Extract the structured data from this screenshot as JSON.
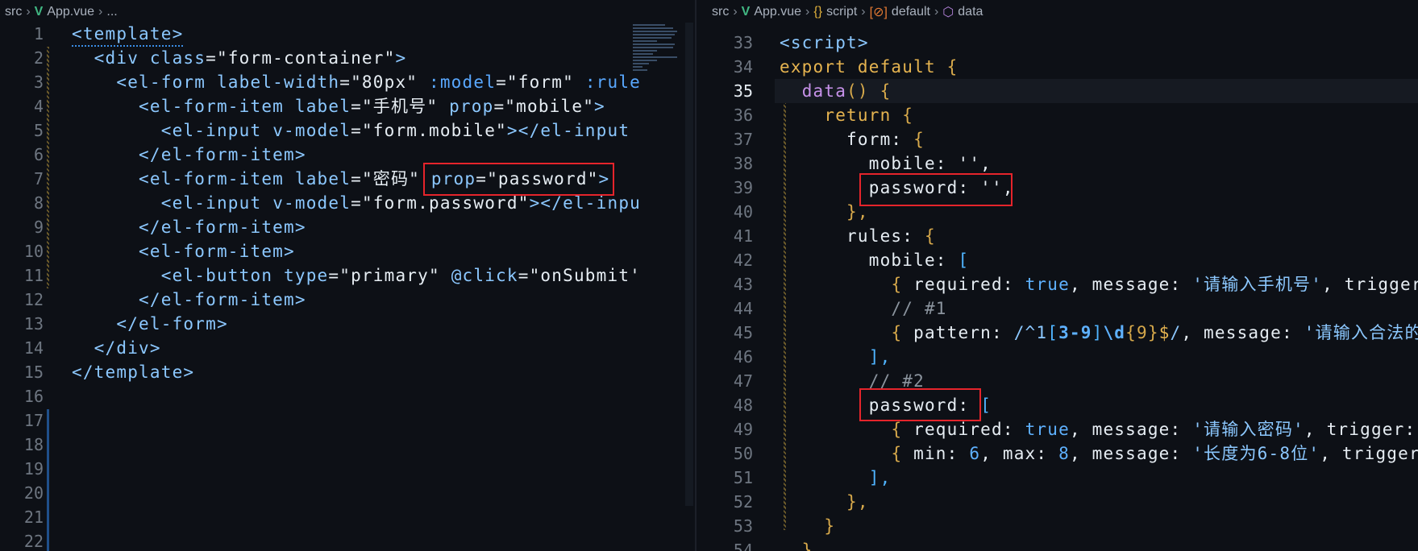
{
  "left": {
    "breadcrumb": [
      "src",
      "App.vue",
      "..."
    ],
    "lines": [
      {
        "n": "1",
        "tokens": [
          [
            "<template>",
            "t"
          ]
        ]
      },
      {
        "n": "2",
        "tokens": [
          [
            "  <div ",
            "t"
          ],
          [
            "class",
            "a"
          ],
          [
            "=",
            "p"
          ],
          [
            "\"form-container\"",
            "s"
          ],
          [
            ">",
            "t"
          ]
        ]
      },
      {
        "n": "3",
        "tokens": [
          [
            "    <el-form ",
            "t"
          ],
          [
            "label-width",
            "a"
          ],
          [
            "=",
            "p"
          ],
          [
            "\"80px\" ",
            "s"
          ],
          [
            ":model",
            "d"
          ],
          [
            "=",
            "p"
          ],
          [
            "\"form\" ",
            "s"
          ],
          [
            ":rule",
            "d"
          ]
        ]
      },
      {
        "n": "4",
        "tokens": [
          [
            "      <el-form-item ",
            "t"
          ],
          [
            "label",
            "a"
          ],
          [
            "=",
            "p"
          ],
          [
            "\"手机号\" ",
            "s"
          ],
          [
            "prop",
            "a"
          ],
          [
            "=",
            "p"
          ],
          [
            "\"mobile\"",
            "s"
          ],
          [
            ">",
            "t"
          ]
        ]
      },
      {
        "n": "5",
        "tokens": [
          [
            "        <el-input ",
            "t"
          ],
          [
            "v-model",
            "a"
          ],
          [
            "=",
            "p"
          ],
          [
            "\"form.mobile\"",
            "s"
          ],
          [
            "></el-input",
            "t"
          ]
        ]
      },
      {
        "n": "6",
        "tokens": [
          [
            "      </el-form-item>",
            "t"
          ]
        ]
      },
      {
        "n": "7",
        "tokens": [
          [
            "      <el-form-item ",
            "t"
          ],
          [
            "label",
            "a"
          ],
          [
            "=",
            "p"
          ],
          [
            "\"密码\" ",
            "s"
          ],
          [
            "prop",
            "a"
          ],
          [
            "=",
            "p"
          ],
          [
            "\"password\"",
            "s"
          ],
          [
            ">",
            "t"
          ]
        ]
      },
      {
        "n": "8",
        "tokens": [
          [
            "        <el-input ",
            "t"
          ],
          [
            "v-model",
            "a"
          ],
          [
            "=",
            "p"
          ],
          [
            "\"form.password\"",
            "s"
          ],
          [
            "></el-inpu",
            "t"
          ]
        ]
      },
      {
        "n": "9",
        "tokens": [
          [
            "      </el-form-item>",
            "t"
          ]
        ]
      },
      {
        "n": "10",
        "tokens": [
          [
            "      <el-form-item>",
            "t"
          ]
        ]
      },
      {
        "n": "11",
        "tokens": [
          [
            "        <el-button ",
            "t"
          ],
          [
            "type",
            "a"
          ],
          [
            "=",
            "p"
          ],
          [
            "\"primary\" ",
            "s"
          ],
          [
            "@click",
            "a"
          ],
          [
            "=",
            "p"
          ],
          [
            "\"onSubmit'",
            "s"
          ]
        ]
      },
      {
        "n": "12",
        "tokens": [
          [
            "      </el-form-item>",
            "t"
          ]
        ]
      },
      {
        "n": "13",
        "tokens": [
          [
            "    </el-form>",
            "t"
          ]
        ]
      },
      {
        "n": "14",
        "tokens": [
          [
            "  </div>",
            "t"
          ]
        ]
      },
      {
        "n": "15",
        "tokens": [
          [
            "</template>",
            "t"
          ]
        ]
      },
      {
        "n": "16",
        "tokens": []
      },
      {
        "n": "17",
        "tokens": []
      },
      {
        "n": "18",
        "tokens": []
      },
      {
        "n": "19",
        "tokens": []
      },
      {
        "n": "20",
        "tokens": []
      },
      {
        "n": "21",
        "tokens": []
      },
      {
        "n": "22",
        "tokens": []
      }
    ]
  },
  "right": {
    "breadcrumb": [
      "src",
      "App.vue",
      "script",
      "default",
      "data"
    ],
    "current_line": "35",
    "lines": [
      {
        "n": "33",
        "tokens": [
          [
            "<script>",
            "t"
          ]
        ]
      },
      {
        "n": "34",
        "tokens": [
          [
            "export default ",
            "k"
          ],
          [
            "{",
            "br"
          ]
        ]
      },
      {
        "n": "35",
        "tokens": [
          [
            "  ",
            "p"
          ],
          [
            "data",
            "f"
          ],
          [
            "() ",
            "br"
          ],
          [
            "{",
            "br"
          ]
        ]
      },
      {
        "n": "36",
        "tokens": [
          [
            "    return ",
            "k"
          ],
          [
            "{",
            "br"
          ]
        ]
      },
      {
        "n": "37",
        "tokens": [
          [
            "      form: ",
            "p"
          ],
          [
            "{",
            "br"
          ]
        ]
      },
      {
        "n": "38",
        "tokens": [
          [
            "        mobile: '',",
            "p"
          ]
        ]
      },
      {
        "n": "39",
        "tokens": [
          [
            "        password: '',",
            "p"
          ]
        ]
      },
      {
        "n": "40",
        "tokens": [
          [
            "      },",
            "br"
          ]
        ]
      },
      {
        "n": "41",
        "tokens": [
          [
            "      rules: ",
            "p"
          ],
          [
            "{",
            "br"
          ]
        ]
      },
      {
        "n": "42",
        "tokens": [
          [
            "        mobile: ",
            "p"
          ],
          [
            "[",
            "bk"
          ]
        ]
      },
      {
        "n": "43",
        "tokens": [
          [
            "          ",
            "p"
          ],
          [
            "{",
            "br"
          ],
          [
            " required: ",
            "p"
          ],
          [
            "true",
            "b"
          ],
          [
            ", message: ",
            "p"
          ],
          [
            "'请输入手机号'",
            "a"
          ],
          [
            ", trigger",
            "p"
          ]
        ]
      },
      {
        "n": "44",
        "tokens": [
          [
            "          // #1",
            "c"
          ]
        ]
      },
      {
        "n": "45",
        "tokens": [
          [
            "          ",
            "p"
          ],
          [
            "{",
            "br"
          ],
          [
            " pattern: ",
            "p"
          ],
          [
            "/^1",
            "a"
          ],
          [
            "[",
            "bk"
          ],
          [
            "3-9",
            "rx"
          ],
          [
            "]",
            "bk"
          ],
          [
            "\\d",
            "rx"
          ],
          [
            "{9}",
            "br"
          ],
          [
            "$",
            "k"
          ],
          [
            "/",
            "a"
          ],
          [
            ", message: ",
            "p"
          ],
          [
            "'请输入合法的",
            "a"
          ]
        ]
      },
      {
        "n": "46",
        "tokens": [
          [
            "        ],",
            "bk"
          ]
        ]
      },
      {
        "n": "47",
        "tokens": [
          [
            "        // #2",
            "c"
          ]
        ]
      },
      {
        "n": "48",
        "tokens": [
          [
            "        password: ",
            "p"
          ],
          [
            "[",
            "bk"
          ]
        ]
      },
      {
        "n": "49",
        "tokens": [
          [
            "          ",
            "p"
          ],
          [
            "{",
            "br"
          ],
          [
            " required: ",
            "p"
          ],
          [
            "true",
            "b"
          ],
          [
            ", message: ",
            "p"
          ],
          [
            "'请输入密码'",
            "a"
          ],
          [
            ", trigger:",
            "p"
          ]
        ]
      },
      {
        "n": "50",
        "tokens": [
          [
            "          ",
            "p"
          ],
          [
            "{",
            "br"
          ],
          [
            " min: ",
            "p"
          ],
          [
            "6",
            "b"
          ],
          [
            ", max: ",
            "p"
          ],
          [
            "8",
            "b"
          ],
          [
            ", message: ",
            "p"
          ],
          [
            "'长度为6-8位'",
            "a"
          ],
          [
            ", trigger",
            "p"
          ]
        ]
      },
      {
        "n": "51",
        "tokens": [
          [
            "        ],",
            "bk"
          ]
        ]
      },
      {
        "n": "52",
        "tokens": [
          [
            "      },",
            "br"
          ]
        ]
      },
      {
        "n": "53",
        "tokens": [
          [
            "    }",
            "br"
          ]
        ]
      },
      {
        "n": "54",
        "tokens": [
          [
            "  }",
            "br"
          ]
        ]
      }
    ]
  },
  "colors": {
    "background": "#0d1016",
    "highlight_box": "#e5242b"
  }
}
